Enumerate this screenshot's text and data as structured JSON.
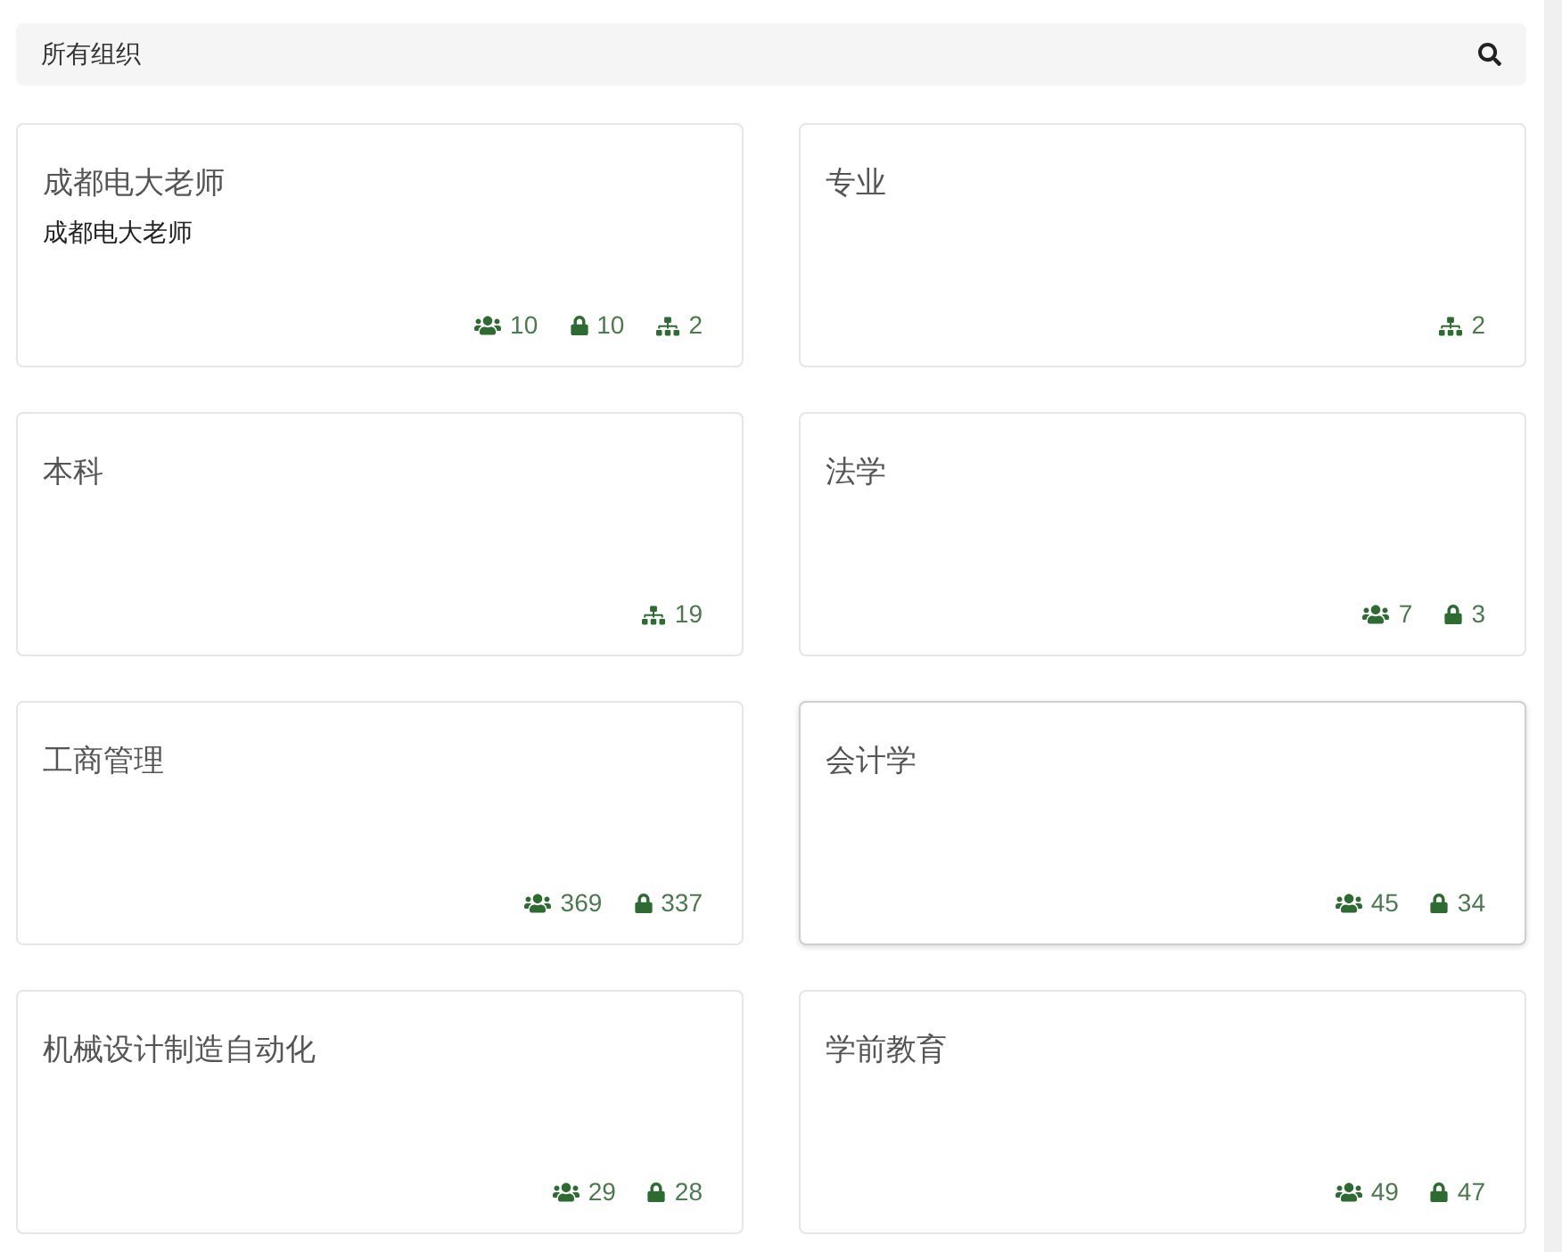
{
  "search": {
    "value": "所有组织"
  },
  "cards": [
    {
      "title": "成都电大老师",
      "subtitle": "成都电大老师",
      "hovered": false,
      "stats": [
        {
          "kind": "members",
          "value": "10"
        },
        {
          "kind": "locks",
          "value": "10"
        },
        {
          "kind": "units",
          "value": "2"
        }
      ]
    },
    {
      "title": "专业",
      "hovered": false,
      "stats": [
        {
          "kind": "units",
          "value": "2"
        }
      ]
    },
    {
      "title": "本科",
      "hovered": false,
      "stats": [
        {
          "kind": "units",
          "value": "19"
        }
      ]
    },
    {
      "title": "法学",
      "hovered": false,
      "stats": [
        {
          "kind": "members",
          "value": "7"
        },
        {
          "kind": "locks",
          "value": "3"
        }
      ]
    },
    {
      "title": "工商管理",
      "hovered": false,
      "stats": [
        {
          "kind": "members",
          "value": "369"
        },
        {
          "kind": "locks",
          "value": "337"
        }
      ]
    },
    {
      "title": "会计学",
      "hovered": true,
      "stats": [
        {
          "kind": "members",
          "value": "45"
        },
        {
          "kind": "locks",
          "value": "34"
        }
      ]
    },
    {
      "title": "机械设计制造自动化",
      "hovered": false,
      "stats": [
        {
          "kind": "members",
          "value": "29"
        },
        {
          "kind": "locks",
          "value": "28"
        }
      ]
    },
    {
      "title": "学前教育",
      "hovered": false,
      "stats": [
        {
          "kind": "members",
          "value": "49"
        },
        {
          "kind": "locks",
          "value": "47"
        }
      ]
    }
  ]
}
